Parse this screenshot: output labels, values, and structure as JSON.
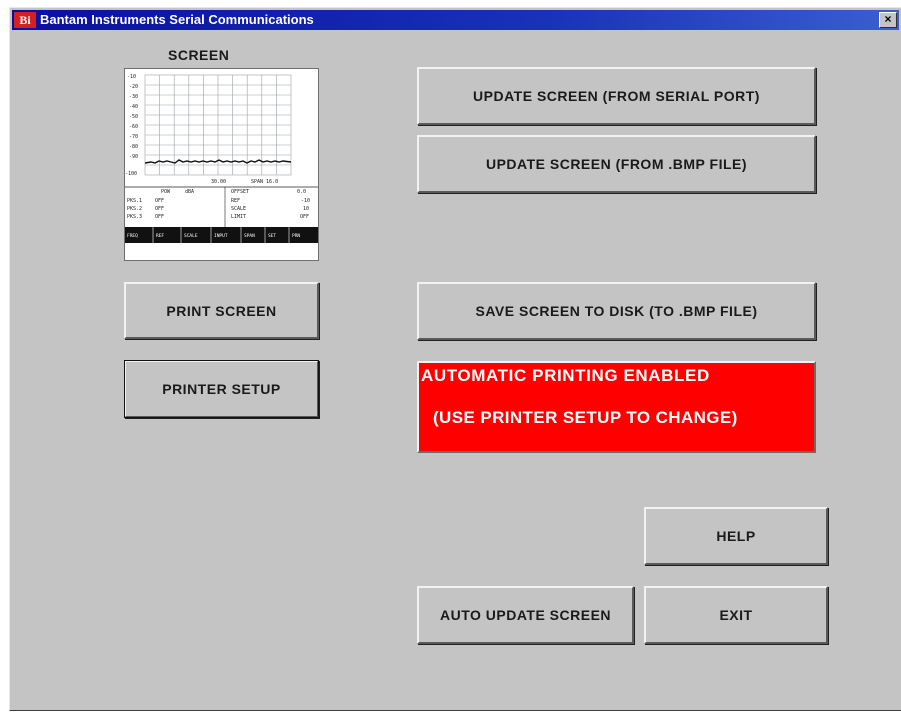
{
  "window": {
    "icon_text": "Bi",
    "title": "Bantam Instruments Serial Communications",
    "close_glyph": "×"
  },
  "screen_panel": {
    "label": "SCREEN"
  },
  "buttons": {
    "update_serial": "UPDATE SCREEN  (FROM SERIAL PORT)",
    "update_bmp": "UPDATE SCREEN  (FROM .BMP FILE)",
    "print_screen": "PRINT SCREEN",
    "save_screen": "SAVE SCREEN TO DISK (TO .BMP FILE)",
    "printer_setup": "PRINTER  SETUP",
    "help": "HELP",
    "auto_update": "AUTO UPDATE SCREEN",
    "exit": "EXIT"
  },
  "status": {
    "line1": "AUTOMATIC  PRINTING  ENABLED",
    "line2": "(USE PRINTER SETUP TO CHANGE)",
    "color": "#ff0000"
  }
}
